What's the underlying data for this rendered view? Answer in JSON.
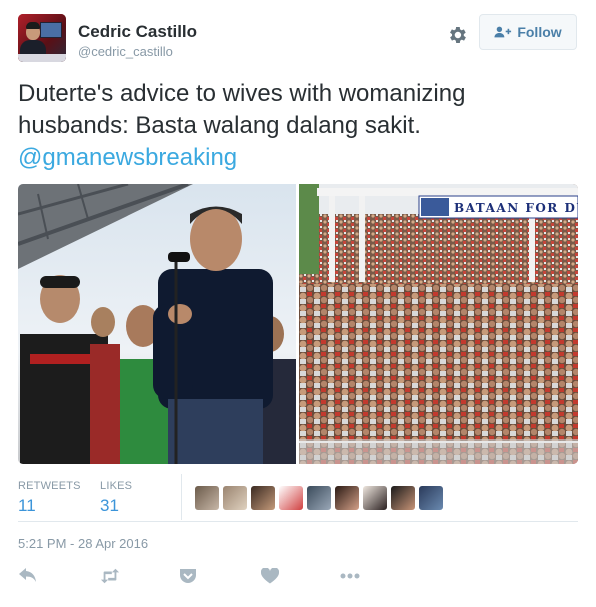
{
  "user": {
    "name": "Cedric Castillo",
    "handle": "@cedric_castillo"
  },
  "follow_button": {
    "label": "Follow"
  },
  "tweet": {
    "text": "Duterte's advice to wives with womanizing husbands: Basta walang dalang sakit.",
    "mention": "@gmanewsbreaking"
  },
  "photos": {
    "right_banner_text": "BATAAN FOR DU"
  },
  "stats": {
    "retweets_label": "RETWEETS",
    "retweets_value": "11",
    "likes_label": "LIKES",
    "likes_value": "31"
  },
  "timestamp": "5:21 PM - 28 Apr 2016",
  "colors": {
    "accent": "#3ba9e0",
    "follow_text": "#4a7fa8",
    "muted": "#8899a6",
    "icon": "#aab8c2"
  },
  "icons": [
    "gear-icon",
    "follow-person-icon",
    "reply-icon",
    "retweet-icon",
    "pocket-icon",
    "heart-icon",
    "more-icon"
  ]
}
